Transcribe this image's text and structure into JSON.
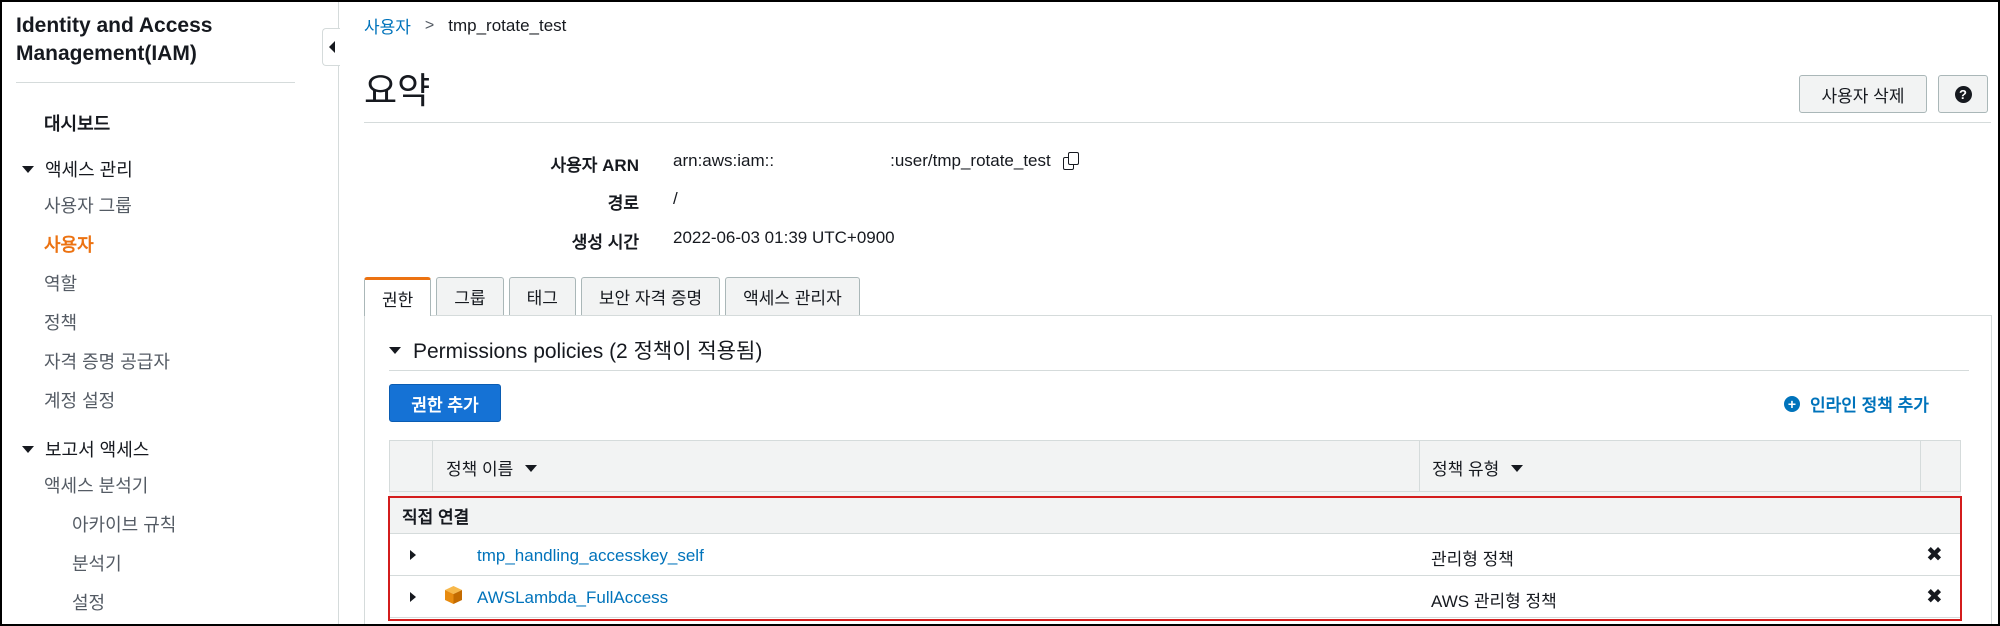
{
  "sidebar": {
    "app_title": "Identity and Access Management(IAM)",
    "dashboard": "대시보드",
    "access_management": {
      "label": "액세스 관리",
      "items": [
        "사용자 그룹",
        "사용자",
        "역할",
        "정책",
        "자격 증명 공급자",
        "계정 설정"
      ],
      "active_item": "사용자"
    },
    "reports": {
      "label": "보고서 액세스",
      "items": [
        "액세스 분석기"
      ],
      "sub_items": [
        "아카이브 규칙",
        "분석기",
        "설정"
      ]
    }
  },
  "breadcrumb": {
    "parent": "사용자",
    "current": "tmp_rotate_test"
  },
  "page": {
    "title": "요약",
    "delete_button": "사용자 삭제",
    "help_glyph": "?"
  },
  "summary": {
    "arn_label": "사용자 ARN",
    "arn_prefix": "arn:aws:iam::",
    "arn_suffix": ":user/tmp_rotate_test",
    "path_label": "경로",
    "path_value": "/",
    "created_label": "생성 시간",
    "created_value": "2022-06-03 01:39 UTC+0900"
  },
  "tabs": [
    "권한",
    "그룹",
    "태그",
    "보안 자격 증명",
    "액세스 관리자"
  ],
  "active_tab": "권한",
  "permissions": {
    "section_title": "Permissions policies (2 정책이 적용됨)",
    "add_button": "권한 추가",
    "inline_add": "인라인 정책 추가",
    "table": {
      "columns": [
        "정책 이름",
        "정책 유형"
      ],
      "group_label": "직접 연결",
      "rows": [
        {
          "name": "tmp_handling_accesskey_self",
          "type": "관리형 정책",
          "icon": null
        },
        {
          "name": "AWSLambda_FullAccess",
          "type": "AWS 관리형 정책",
          "icon": "aws-managed-box-icon"
        }
      ],
      "remove_glyph": "✖"
    }
  },
  "colors": {
    "accent_orange": "#ec7211",
    "link_blue": "#0073bb",
    "primary_button": "#1572d5",
    "highlight_red": "#d31c1c"
  }
}
